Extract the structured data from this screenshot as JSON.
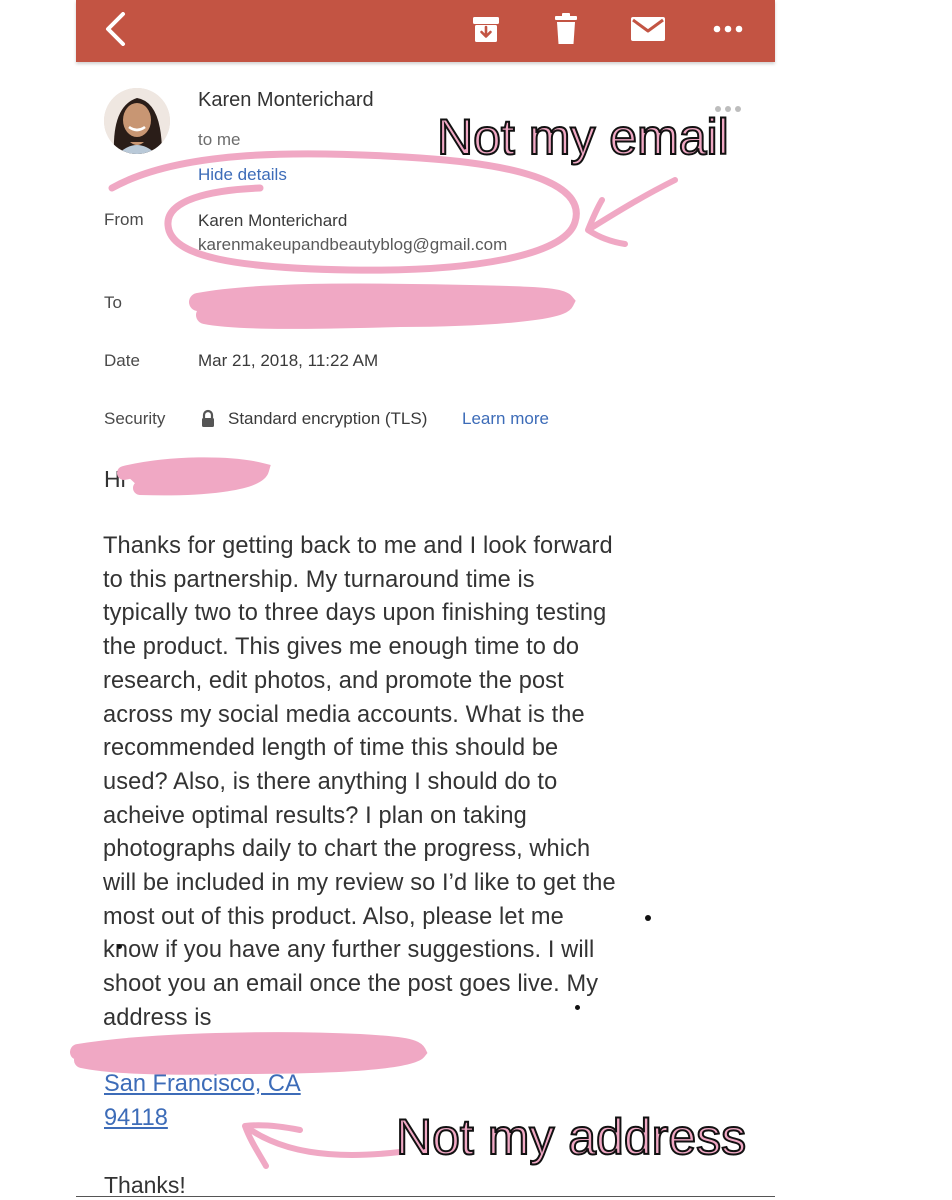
{
  "toolbar": {
    "icons": [
      "back-arrow-icon",
      "archive-icon",
      "trash-icon",
      "mail-icon",
      "more-icon"
    ],
    "color": "#c35443"
  },
  "message": {
    "sender_name": "Karen Monterichard",
    "to_line": "to me",
    "hide_details": "Hide details"
  },
  "details": {
    "from_label": "From",
    "from_name": "Karen Monterichard",
    "from_email": "karenmakeupandbeautyblog@gmail.com",
    "to_label": "To",
    "date_label": "Date",
    "date_value": "Mar 21, 2018, 11:22 AM",
    "security_label": "Security",
    "security_value": "Standard encryption (TLS)",
    "learn_more": "Learn more"
  },
  "body": {
    "greeting": "Hi",
    "paragraph_lines": [
      "Thanks for getting back to me and I look forward",
      "to this partnership. My turnaround time is",
      "typically two to three days upon finishing testing",
      "the product. This gives me enough time to do",
      "research, edit photos, and promote the post",
      "across my social media accounts. What is the",
      "recommended length of time this should be",
      "used? Also, is there anything I should do to",
      "acheive optimal results? I plan on taking",
      "photographs daily to chart the progress, which",
      "will be included in my review so I’d like to get the",
      "most out of this product. Also, please let me",
      "know if you have any further suggestions. I will",
      "shoot you an email once the post goes live. My",
      "address is"
    ],
    "address_city": "San Francisco, CA",
    "address_zip": "94118",
    "closing": "Thanks!"
  },
  "annotations": {
    "email_note": "Not my email",
    "address_note": "Not my address",
    "ink_color": "#f0a8c4"
  }
}
